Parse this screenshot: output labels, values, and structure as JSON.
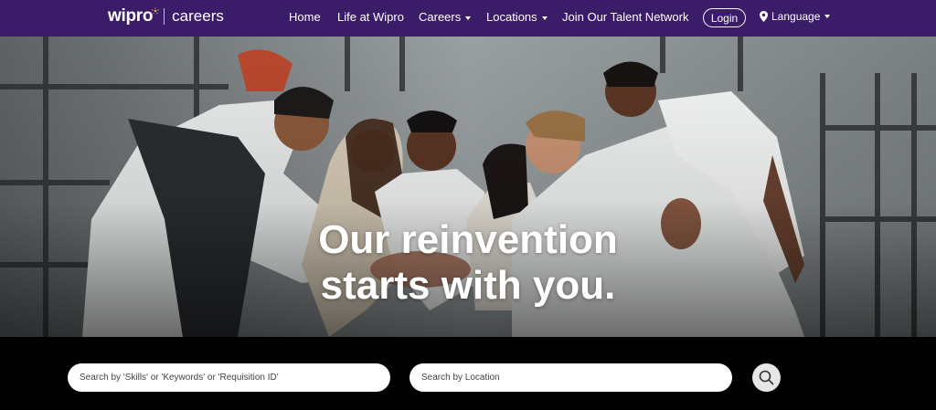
{
  "brand": {
    "logo": "wipro",
    "section": "careers"
  },
  "nav": {
    "home": "Home",
    "life": "Life at Wipro",
    "careers": "Careers",
    "locations": "Locations",
    "talent": "Join Our Talent Network",
    "login": "Login",
    "language": "Language"
  },
  "hero": {
    "line1": "Our reinvention",
    "line2": "starts with you."
  },
  "search": {
    "keywords_placeholder": "Search by 'Skills' or 'Keywords' or 'Requisition ID'",
    "location_placeholder": "Search by Location"
  },
  "colors": {
    "nav_bg": "#3b1c68",
    "search_bg": "#000000"
  },
  "icons": [
    "map-pin-icon",
    "search-icon",
    "caret-down-icon"
  ]
}
